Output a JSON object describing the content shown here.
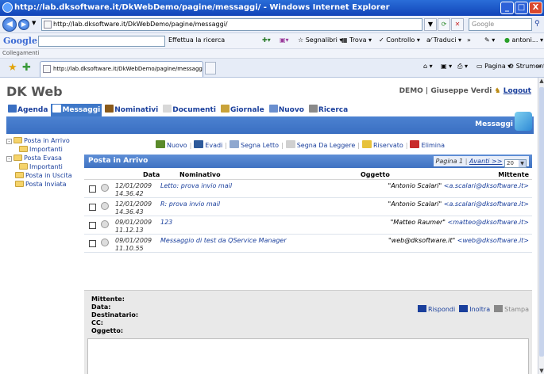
{
  "window": {
    "title": "http://lab.dksoftware.it/DkWebDemo/pagine/messaggi/ - Windows Internet Explorer",
    "buttons": [
      "_",
      "□",
      "X"
    ]
  },
  "address_bar": {
    "url": "http://lab.dksoftware.it/DkWebDemo/pagine/messaggi/",
    "search_placeholder": "Google"
  },
  "google_toolbar": {
    "logo": "Google 8",
    "search_label": "Effettua la ricerca",
    "items": [
      "Segnalibri",
      "Trova",
      "Controllo",
      "Traduci",
      "»",
      "antoni..."
    ]
  },
  "links_bar": {
    "label": "Collegamenti"
  },
  "tab": {
    "url": "http://lab.dksoftware.it/DkWebDemo/pagine/messaggi/",
    "tools": [
      "Pagina",
      "Strumenti",
      "»"
    ]
  },
  "app": {
    "title": "DK Web",
    "user": "DEMO | Giuseppe Verdi",
    "logout": "Logout",
    "nav": [
      {
        "label": "Agenda",
        "color": "#3a6fc2"
      },
      {
        "label": "Messaggi",
        "color": "#ffffff",
        "active": true
      },
      {
        "label": "Nominativi",
        "color": "#8a5a1a"
      },
      {
        "label": "Documenti",
        "color": "#d8d8d8"
      },
      {
        "label": "Giornale",
        "color": "#c9a33a"
      },
      {
        "label": "Nuovo",
        "color": "#6a8fcf"
      },
      {
        "label": "Ricerca",
        "color": "#8a8a8a"
      }
    ],
    "section_label": "Messaggi"
  },
  "folders": [
    {
      "label": "Posta in Arrivo",
      "expander": "-",
      "indent": 0
    },
    {
      "label": "Importanti",
      "expander": "",
      "indent": 1
    },
    {
      "label": "Posta Evasa",
      "expander": "-",
      "indent": 0
    },
    {
      "label": "Importanti",
      "expander": "",
      "indent": 1
    },
    {
      "label": "Posta in Uscita",
      "expander": "",
      "indent": 0
    },
    {
      "label": "Posta Inviata",
      "expander": "",
      "indent": 0
    }
  ],
  "actions": [
    {
      "label": "Nuovo",
      "color": "#5a8a2a"
    },
    {
      "label": "Evadi",
      "color": "#2e5a9a"
    },
    {
      "label": "Segna Letto",
      "color": "#8fa8cf"
    },
    {
      "label": "Segna Da Leggere",
      "color": "#d0d0d0"
    },
    {
      "label": "Riservato",
      "color": "#e7c23a"
    },
    {
      "label": "Elimina",
      "color": "#c82a2a"
    }
  ],
  "inbox": {
    "title": "Posta in Arrivo",
    "page_label": "Pagina 1",
    "next_label": "Avanti >>",
    "page_size": "20",
    "columns": {
      "date": "Data",
      "name": "Nominativo",
      "subject": "Oggetto",
      "sender": "Mittente"
    },
    "messages": [
      {
        "date": "12/01/2009",
        "time": "14.36.42",
        "subject": "Letto: prova invio mail",
        "sender_name": "\"Antonio Scalari\"",
        "sender_email": "<a.scalari@dksoftware.it>"
      },
      {
        "date": "12/01/2009",
        "time": "14.36.43",
        "subject": "R: prova invio mail",
        "sender_name": "\"Antonio Scalari\"",
        "sender_email": "<a.scalari@dksoftware.it>"
      },
      {
        "date": "09/01/2009",
        "time": "11.12.13",
        "subject": "123",
        "sender_name": "\"Matteo Raumer\"",
        "sender_email": "<matteo@dksoftware.it>"
      },
      {
        "date": "09/01/2009",
        "time": "11.10.55",
        "subject": "Messaggio di test da QService Manager",
        "sender_name": "\"web@dksoftware.it\"",
        "sender_email": "<web@dksoftware.it>"
      }
    ]
  },
  "detail": {
    "fields": [
      "Mittente:",
      "Data:",
      "Destinatario:",
      "CC:",
      "Oggetto:"
    ],
    "actions": [
      {
        "label": "Rispondi",
        "color": "#1a3f9c"
      },
      {
        "label": "Inoltra",
        "color": "#1a3f9c"
      },
      {
        "label": "Stampa",
        "color": "#888888"
      }
    ]
  }
}
